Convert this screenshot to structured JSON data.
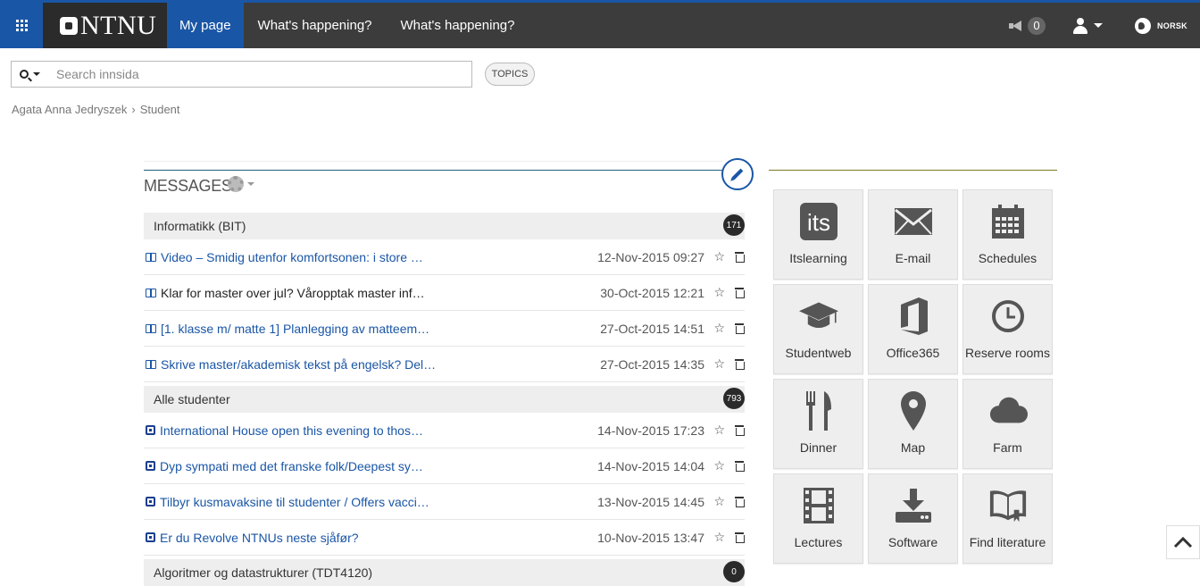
{
  "topbar": {
    "logo_text": "NTNU",
    "nav": [
      "My page",
      "What's happening?",
      "What's happening?"
    ],
    "notification_count": "0",
    "language": "NORSK"
  },
  "search": {
    "placeholder": "Search innsida",
    "topics_label": "TOPICS"
  },
  "breadcrumb": {
    "items": [
      "Agata Anna Jedryszek",
      "Student"
    ]
  },
  "messages": {
    "title": "MESSAGES",
    "groups": [
      {
        "name": "Informatikk (BIT)",
        "count": "171",
        "items": [
          {
            "title": "Video – Smidig utenfor komfortsonen: i store …",
            "date": "12-Nov-2015 09:27",
            "read": false
          },
          {
            "title": "Klar for master over jul? Våropptak master inf…",
            "date": "30-Oct-2015 12:21",
            "read": true
          },
          {
            "title": "[1. klasse m/ matte 1] Planlegging av matteem…",
            "date": "27-Oct-2015 14:51",
            "read": false
          },
          {
            "title": "Skrive master/akademisk tekst på engelsk? Del…",
            "date": "27-Oct-2015 14:35",
            "read": false
          }
        ]
      },
      {
        "name": "Alle studenter",
        "count": "793",
        "items": [
          {
            "title": "International House open this evening to thos…",
            "date": "14-Nov-2015 17:23",
            "read": false
          },
          {
            "title": "Dyp sympati med det franske folk/Deepest sy…",
            "date": "14-Nov-2015 14:04",
            "read": false
          },
          {
            "title": "Tilbyr kusmavaksine til studenter / Offers vacci…",
            "date": "13-Nov-2015 14:45",
            "read": false
          },
          {
            "title": "Er du Revolve NTNUs neste sjåfør?",
            "date": "10-Nov-2015 13:47",
            "read": false
          }
        ]
      },
      {
        "name": "Algoritmer og datastrukturer (TDT4120)",
        "count": "0",
        "items": []
      }
    ]
  },
  "tiles": [
    {
      "label": "Itslearning",
      "icon": "itslearning-icon"
    },
    {
      "label": "E-mail",
      "icon": "envelope-icon"
    },
    {
      "label": "Schedules",
      "icon": "calendar-icon"
    },
    {
      "label": "Studentweb",
      "icon": "graduation-cap-icon"
    },
    {
      "label": "Office365",
      "icon": "office-icon"
    },
    {
      "label": "Reserve rooms",
      "icon": "clock-icon"
    },
    {
      "label": "Dinner",
      "icon": "fork-knife-icon"
    },
    {
      "label": "Map",
      "icon": "map-pin-icon"
    },
    {
      "label": "Farm",
      "icon": "cloud-icon"
    },
    {
      "label": "Lectures",
      "icon": "film-icon"
    },
    {
      "label": "Software",
      "icon": "download-icon"
    },
    {
      "label": "Find literature",
      "icon": "book-icon"
    }
  ],
  "colors": {
    "brand_blue": "#1a56a6",
    "topbar": "#3c3c3c",
    "tile_icon": "#555555"
  }
}
